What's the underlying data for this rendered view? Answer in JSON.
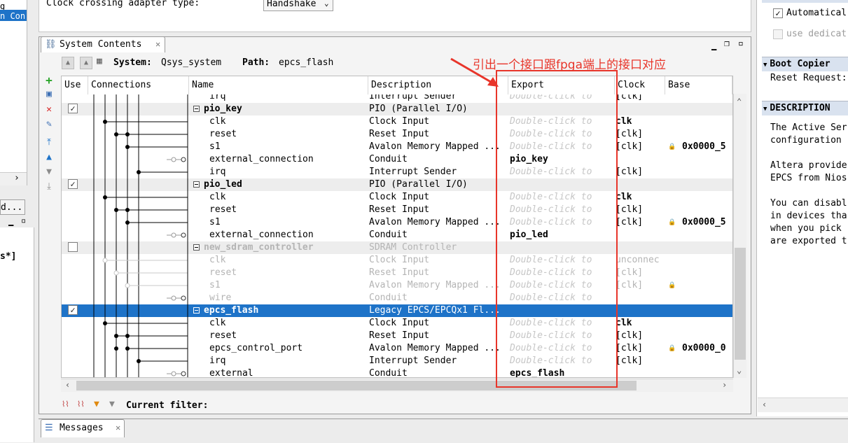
{
  "top": {
    "clock_label": "Clock crossing adapter type:",
    "clock_value": "Handshake",
    "left_row1": "g",
    "left_row2": "n Con",
    "left_btn": "d...",
    "left_mid_text": "s*]"
  },
  "system_panel": {
    "tab_label": "System Contents",
    "system_label": "System:",
    "system_value": "Qsys_system",
    "path_label": "Path:",
    "path_value": "epcs_flash",
    "filter_label": "Current filter:"
  },
  "columns": {
    "use": "Use",
    "connections": "Connections",
    "name": "Name",
    "description": "Description",
    "export": "Export",
    "clock": "Clock",
    "base": "Base"
  },
  "rows": [
    {
      "name": "irq",
      "desc": "Interrupt Sender",
      "export": "Double-click to",
      "clock": "[clk]",
      "base": "",
      "type": "partial"
    },
    {
      "name": "pio_key",
      "desc": "PIO (Parallel I/O)",
      "export": "",
      "clock": "",
      "base": "",
      "type": "comp",
      "checked": true
    },
    {
      "name": "clk",
      "desc": "Clock Input",
      "export": "Double-click to",
      "clock": "clk",
      "base": "",
      "type": "iface",
      "clockBold": true
    },
    {
      "name": "reset",
      "desc": "Reset Input",
      "export": "Double-click to",
      "clock": "[clk]",
      "base": "",
      "type": "iface"
    },
    {
      "name": "s1",
      "desc": "Avalon Memory Mapped ...",
      "export": "Double-click to",
      "clock": "[clk]",
      "base": "0x0000_5",
      "type": "iface"
    },
    {
      "name": "external_connection",
      "desc": "Conduit",
      "export": "pio_key",
      "clock": "",
      "base": "",
      "type": "iface",
      "exportBold": true
    },
    {
      "name": "irq",
      "desc": "Interrupt Sender",
      "export": "Double-click to",
      "clock": "[clk]",
      "base": "",
      "type": "iface"
    },
    {
      "name": "pio_led",
      "desc": "PIO (Parallel I/O)",
      "export": "",
      "clock": "",
      "base": "",
      "type": "comp",
      "checked": true
    },
    {
      "name": "clk",
      "desc": "Clock Input",
      "export": "Double-click to",
      "clock": "clk",
      "base": "",
      "type": "iface",
      "clockBold": true
    },
    {
      "name": "reset",
      "desc": "Reset Input",
      "export": "Double-click to",
      "clock": "[clk]",
      "base": "",
      "type": "iface"
    },
    {
      "name": "s1",
      "desc": "Avalon Memory Mapped ...",
      "export": "Double-click to",
      "clock": "[clk]",
      "base": "0x0000_5",
      "type": "iface"
    },
    {
      "name": "external_connection",
      "desc": "Conduit",
      "export": "pio_led",
      "clock": "",
      "base": "",
      "type": "iface",
      "exportBold": true
    },
    {
      "name": "new_sdram_controller",
      "desc": "SDRAM Controller",
      "export": "",
      "clock": "",
      "base": "",
      "type": "comp",
      "checked": false,
      "dim": true
    },
    {
      "name": "clk",
      "desc": "Clock Input",
      "export": "Double-click to",
      "clock": "unconnec",
      "base": "",
      "type": "iface",
      "dim": true
    },
    {
      "name": "reset",
      "desc": "Reset Input",
      "export": "Double-click to",
      "clock": "[clk]",
      "base": "",
      "type": "iface",
      "dim": true
    },
    {
      "name": "s1",
      "desc": "Avalon Memory Mapped ...",
      "export": "Double-click to",
      "clock": "[clk]",
      "base": "",
      "type": "iface",
      "dim": true
    },
    {
      "name": "wire",
      "desc": "Conduit",
      "export": "Double-click to",
      "clock": "",
      "base": "",
      "type": "iface",
      "dim": true
    },
    {
      "name": "epcs_flash",
      "desc": "Legacy EPCS/EPCQx1 Fl...",
      "export": "",
      "clock": "",
      "base": "",
      "type": "comp",
      "checked": true,
      "selected": true
    },
    {
      "name": "clk",
      "desc": "Clock Input",
      "export": "Double-click to",
      "clock": "clk",
      "base": "",
      "type": "iface",
      "clockBold": true
    },
    {
      "name": "reset",
      "desc": "Reset Input",
      "export": "Double-click to",
      "clock": "[clk]",
      "base": "",
      "type": "iface"
    },
    {
      "name": "epcs_control_port",
      "desc": "Avalon Memory Mapped ...",
      "export": "Double-click to",
      "clock": "[clk]",
      "base": "0x0000_0",
      "type": "iface"
    },
    {
      "name": "irq",
      "desc": "Interrupt Sender",
      "export": "Double-click to",
      "clock": "[clk]",
      "base": "",
      "type": "iface"
    },
    {
      "name": "external",
      "desc": "Conduit",
      "export": "epcs_flash",
      "clock": "",
      "base": "",
      "type": "iface",
      "exportBold": true
    }
  ],
  "right_panel": {
    "checkbox1_label": "Automatical",
    "checkbox2_label": "use dedicat",
    "boot_header": "Boot Copier",
    "reset_request": "Reset Request:",
    "desc_header": "DESCRIPTION",
    "desc_lines": [
      "The Active Ser",
      "configuration",
      "",
      "Altera provide",
      "EPCS from Nios",
      "",
      "You can disabl",
      "in devices tha",
      "when you pick ",
      "are exported t"
    ]
  },
  "messages": {
    "tab_label": "Messages"
  },
  "annotation": {
    "text": "引出一个接口跟fpga端上的接口对应"
  },
  "colors": {
    "selection": "#1e73c8",
    "annotation": "#e8352a"
  }
}
